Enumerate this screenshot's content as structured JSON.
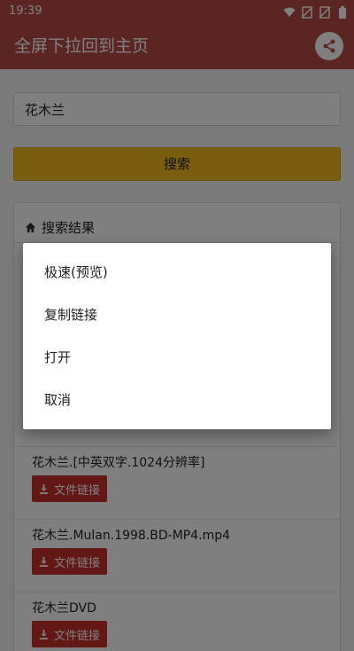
{
  "status_bar": {
    "time": "19:39"
  },
  "app_bar": {
    "title": "全屏下拉回到主页"
  },
  "search": {
    "query": "花木兰",
    "button_label": "搜索"
  },
  "results": {
    "header": "搜索结果",
    "items": [
      {
        "title": "花木兰.[中英双字.1024分辨率]",
        "button_label": "文件链接"
      },
      {
        "title": "花木兰.Mulan.1998.BD-MP4.mp4",
        "button_label": "文件链接"
      },
      {
        "title": "花木兰DVD",
        "button_label": "文件链接"
      }
    ]
  },
  "context_menu": {
    "items": [
      "极速(预览)",
      "复制链接",
      "打开",
      "取消"
    ]
  },
  "colors": {
    "app_bar": "#b64a46",
    "search_button": "#f4bb1c",
    "file_link_button": "#c9302c"
  }
}
